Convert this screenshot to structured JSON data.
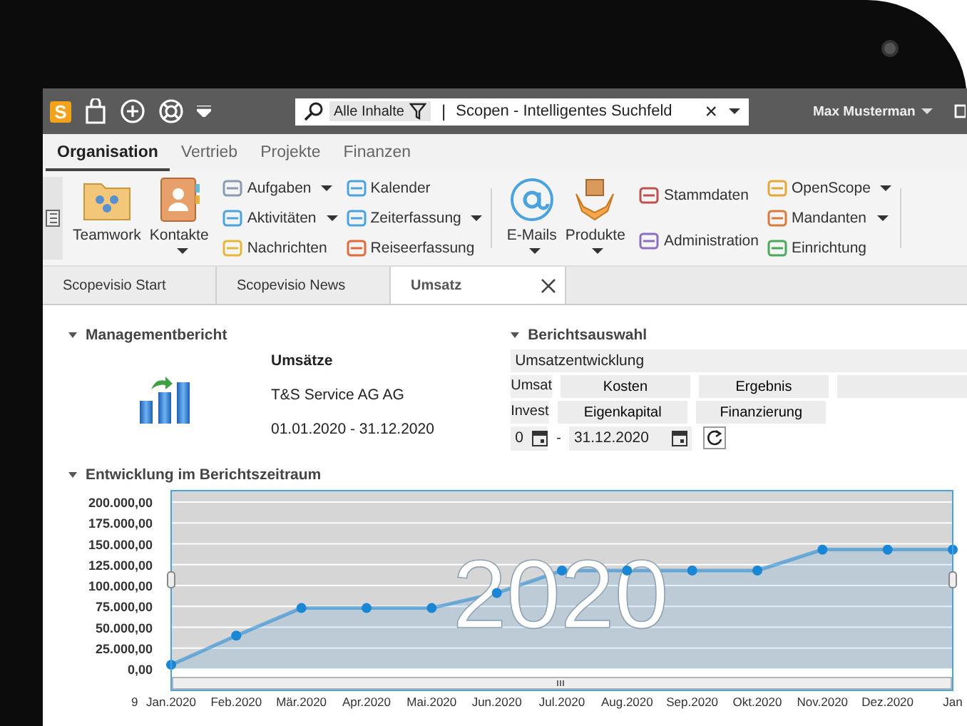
{
  "top_bar": {
    "logo": "S",
    "search": {
      "scope": "Alle Inhalte",
      "separator": "|",
      "placeholder": "Scopen - Intelligentes Suchfeld",
      "clear": "×"
    },
    "user": "Max Musterman"
  },
  "ribbon_tabs": [
    {
      "label": "Organisation",
      "selected": true
    },
    {
      "label": "Vertrieb",
      "selected": false
    },
    {
      "label": "Projekte",
      "selected": false
    },
    {
      "label": "Finanzen",
      "selected": false
    }
  ],
  "ribbon_groups": [
    {
      "kind": "large",
      "items": [
        {
          "label": "Teamwork",
          "dropdown": false
        },
        {
          "label": "Kontakte",
          "dropdown": true
        }
      ]
    },
    {
      "kind": "small",
      "items": [
        {
          "label": "Aufgaben",
          "dropdown": true
        },
        {
          "label": "Aktivitäten",
          "dropdown": true
        },
        {
          "label": "Nachrichten",
          "dropdown": false
        }
      ]
    },
    {
      "kind": "small",
      "items": [
        {
          "label": "Kalender",
          "dropdown": false
        },
        {
          "label": "Zeiterfassung",
          "dropdown": true
        },
        {
          "label": "Reiseerfassung",
          "dropdown": false
        }
      ]
    },
    {
      "kind": "large",
      "items": [
        {
          "label": "E-Mails",
          "dropdown": true
        },
        {
          "label": "Produkte",
          "dropdown": true
        }
      ]
    },
    {
      "kind": "small",
      "items": [
        {
          "label": "Stammdaten",
          "dropdown": false
        },
        {
          "label": "Administration",
          "dropdown": false
        }
      ]
    },
    {
      "kind": "small",
      "items": [
        {
          "label": "OpenScope",
          "dropdown": true
        },
        {
          "label": "Mandanten",
          "dropdown": true
        },
        {
          "label": "Einrichtung",
          "dropdown": false
        }
      ]
    }
  ],
  "doc_tabs": [
    {
      "label": "Scopevisio Start",
      "selected": false,
      "closable": false
    },
    {
      "label": "Scopevisio News",
      "selected": false,
      "closable": false
    },
    {
      "label": "Umsatz",
      "selected": true,
      "closable": true
    }
  ],
  "management_report": {
    "title": "Managementbericht",
    "heading": "Umsätze",
    "company": "T&S Service AG AG",
    "period": "01.01.2020 - 31.12.2020"
  },
  "report_selection": {
    "title": "Berichtsauswahl",
    "selected_report": "Umsatzentwicklung",
    "rows": [
      [
        "Umsat",
        "Kosten",
        "Ergebnis",
        ""
      ],
      [
        "Invest",
        "Eigenkapital",
        "Finanzierung"
      ]
    ],
    "date_from": "0",
    "date_dash": "-",
    "date_to": "31.12.2020"
  },
  "development": {
    "title": "Entwicklung im Berichtszeitraum",
    "year_overlay": "2020",
    "axis_fragment": "9",
    "chart_data": {
      "type": "area",
      "grid": true,
      "categories": [
        "Jan.2020",
        "Feb.2020",
        "Mär.2020",
        "Apr.2020",
        "Mai.2020",
        "Jun.2020",
        "Jul.2020",
        "Aug.2020",
        "Sep.2020",
        "Okt.2020",
        "Nov.2020",
        "Dez.2020",
        "Jan"
      ],
      "series": [
        {
          "color": "#1a86d6",
          "values": [
            5000,
            40000,
            73000,
            73000,
            73000,
            91000,
            118000,
            118000,
            118000,
            118000,
            143000,
            143000,
            143000
          ]
        }
      ],
      "ylim": [
        0,
        200000
      ],
      "yticks": [
        {
          "value": 0,
          "label": "0,00"
        },
        {
          "value": 25000,
          "label": "25.000,00"
        },
        {
          "value": 50000,
          "label": "50.000,00"
        },
        {
          "value": 75000,
          "label": "75.000,00"
        },
        {
          "value": 100000,
          "label": "100.000,00"
        },
        {
          "value": 125000,
          "label": "125.000,00"
        },
        {
          "value": 150000,
          "label": "150.000,00"
        },
        {
          "value": 175000,
          "label": "175.000,00"
        },
        {
          "value": 200000,
          "label": "200.000,00"
        }
      ]
    }
  }
}
